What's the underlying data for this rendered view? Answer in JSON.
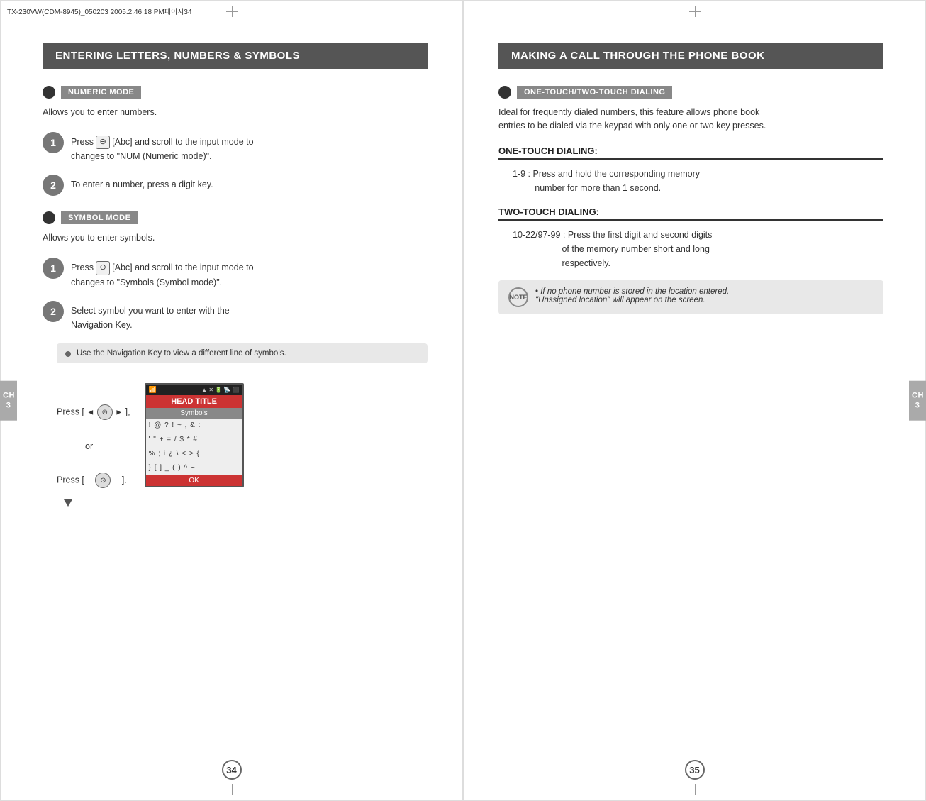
{
  "left_page": {
    "header": "ENTERING LETTERS, NUMBERS & SYMBOLS",
    "numeric_mode": {
      "label": "NUMERIC MODE",
      "description": "Allows you to enter numbers.",
      "steps": [
        {
          "number": "1",
          "text": "Press  [Abc] and scroll to the input mode to\nchanges to \"NUM (Numeric mode)\"."
        },
        {
          "number": "2",
          "text": "To enter a number, press a digit key."
        }
      ]
    },
    "symbol_mode": {
      "label": "SYMBOL MODE",
      "description": "Allows you to enter symbols.",
      "steps": [
        {
          "number": "1",
          "text": "Press  [Abc] and scroll to the input mode to\nchanges to \"Symbols (Symbol mode)\"."
        },
        {
          "number": "2",
          "text": "Select symbol you want to enter with the\nNavigation Key."
        }
      ],
      "note": "Use the Navigation Key to view a different line of symbols."
    },
    "press_labels": {
      "label1": "Press [",
      "arrow_left": "◄",
      "nav_icon": "⊙",
      "arrow_right": "►",
      "bracket1": "],",
      "or_text": "or",
      "label2": "Press [",
      "nav_icon2": "⊙",
      "bracket2": "]."
    },
    "screen": {
      "status_icons": "▲ ✗ 🔋 📶",
      "head_title": "HEAD TITLE",
      "symbols_label": "Symbols",
      "rows": [
        "! @ ? ! ~ , & :",
        "' \" + = / $ * #",
        "% ; i ¿ \\ < > {",
        "} [ ] _ ( ) ^ ~"
      ],
      "ok_label": "OK"
    },
    "page_number": "34",
    "ch_tab": "CH\n3"
  },
  "right_page": {
    "header": "MAKING A CALL THROUGH THE PHONE BOOK",
    "one_touch_two_touch": {
      "label": "ONE-TOUCH/TWO-TOUCH DIALING",
      "description": "Ideal for frequently dialed numbers, this feature allows phone book\nentries to be dialed via the keypad with only one or two key presses.",
      "one_touch_heading": "ONE-TOUCH DIALING:",
      "one_touch_text": "1-9 : Press and hold the corresponding memory\n         number for more than 1 second.",
      "two_touch_heading": "TWO-TOUCH DIALING:",
      "two_touch_text": "10-22/97-99 : Press the first digit and second digits\n                        of the memory number short and long\n                        respectively.",
      "note": "If no phone number is stored in the location entered,\n\"Unssigned location\" will appear on the screen."
    },
    "page_number": "35",
    "ch_tab": "CH\n3"
  }
}
